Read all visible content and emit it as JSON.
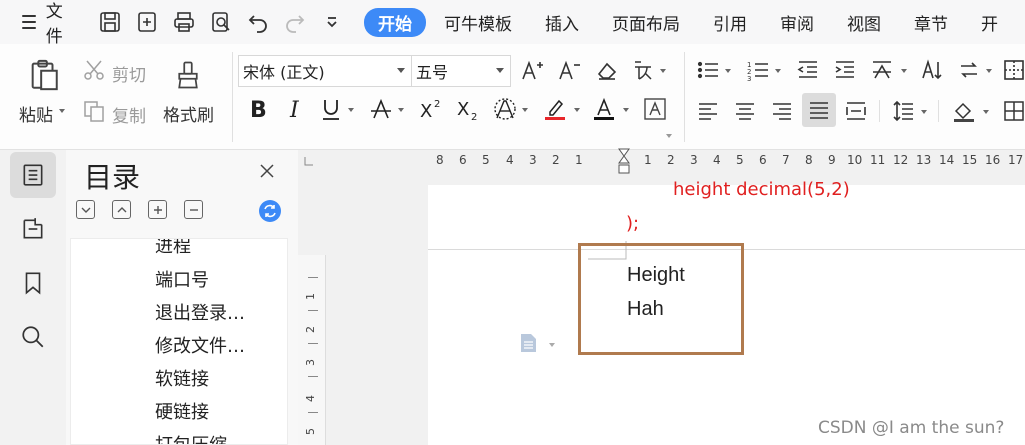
{
  "menubar": {
    "file_label": "文件",
    "tabs": [
      "开始",
      "可牛模板",
      "插入",
      "页面布局",
      "引用",
      "审阅",
      "视图",
      "章节",
      "开"
    ]
  },
  "ribbon": {
    "paste_label": "粘贴",
    "cut_label": "剪切",
    "copy_label": "复制",
    "format_painter_label": "格式刷",
    "font_name": "宋体 (正文)",
    "font_size": "五号"
  },
  "toc": {
    "title": "目录",
    "items": [
      "进程",
      "端口号",
      "退出登录…",
      "修改文件…",
      "软链接",
      "硬链接",
      "打包压缩"
    ]
  },
  "ruler": {
    "h_numbers": [
      "8",
      "6",
      "5",
      "4",
      "3",
      "2",
      "1",
      "",
      "1",
      "2",
      "3",
      "4",
      "5",
      "6",
      "7",
      "8",
      "9",
      "10",
      "11",
      "12",
      "13",
      "14",
      "15",
      "16",
      "17"
    ],
    "v_numbers": [
      "1",
      "2",
      "3",
      "4",
      "5"
    ]
  },
  "document": {
    "code_line_1": "height decimal(5,2)",
    "code_line_2": ");",
    "text_line_1": "Height",
    "text_line_2": "Hah"
  },
  "watermark": "CSDN @I am the sun?"
}
